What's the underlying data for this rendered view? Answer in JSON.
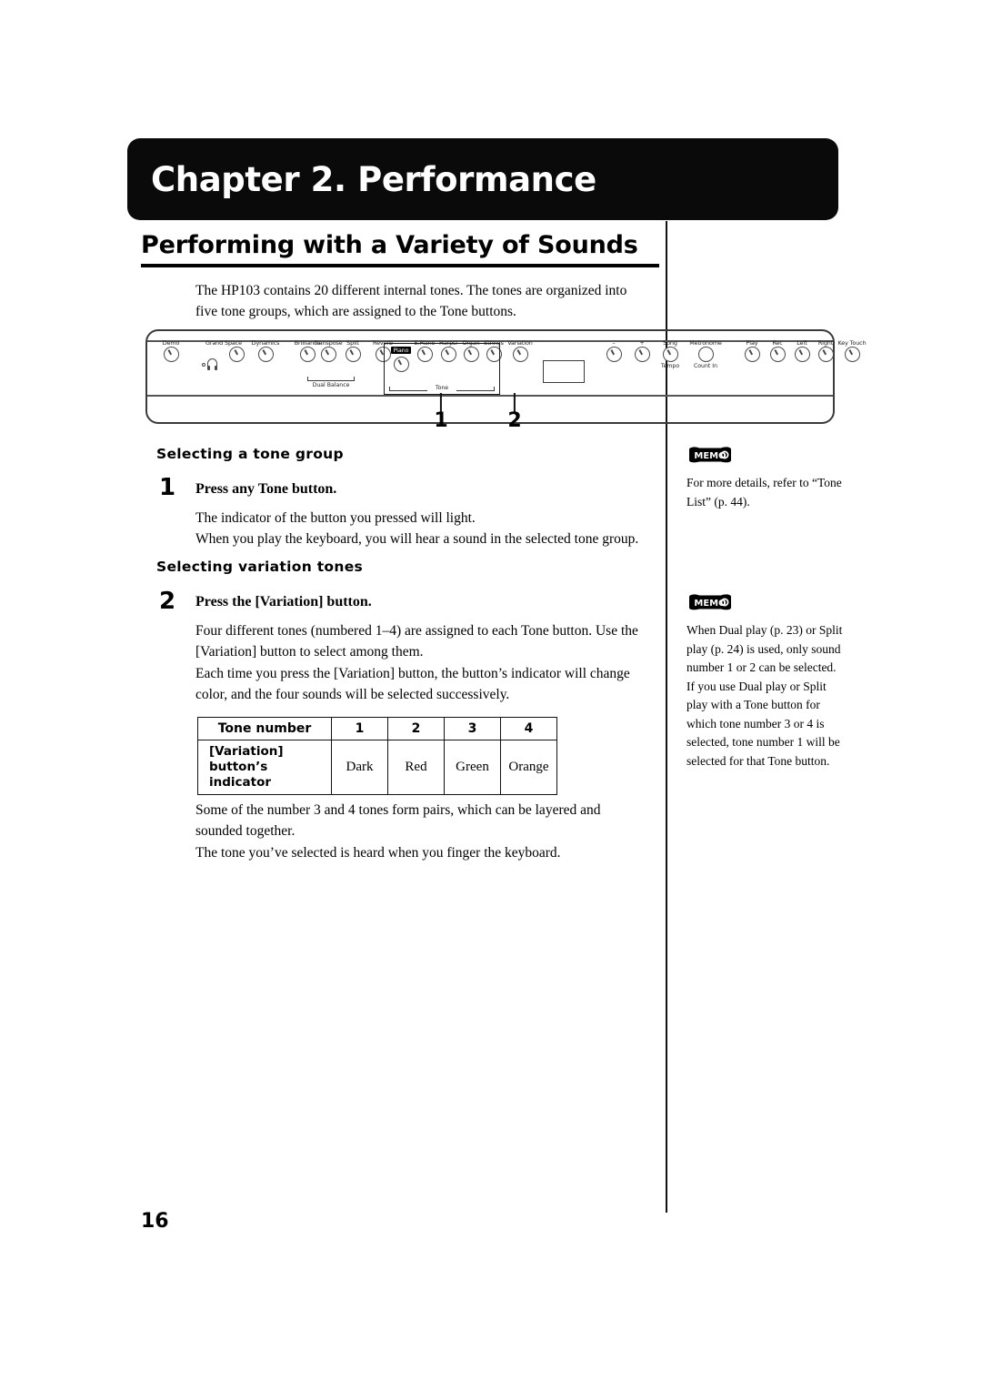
{
  "page": {
    "number": "16"
  },
  "chapter": {
    "title": "Chapter 2. Performance"
  },
  "section": {
    "title": "Performing with a Variety of Sounds",
    "intro": "The HP103 contains 20 different internal tones. The tones are organized into five tone groups, which are assigned to the Tone buttons."
  },
  "panel": {
    "left_controls": [
      {
        "label": "Demo"
      },
      {
        "label": "Grand Space"
      },
      {
        "label": "Dynamics"
      },
      {
        "label": "Brilliance"
      },
      {
        "label": "Transpose"
      },
      {
        "label": "Split"
      },
      {
        "label": "Reverb"
      }
    ],
    "dual_balance_label": "Dual Balance",
    "tone_group_label": "Tone",
    "tone_buttons": [
      {
        "label": "Piano",
        "selected": true
      },
      {
        "label": "E.Piano",
        "selected": false
      },
      {
        "label": "Harpsi",
        "selected": false
      },
      {
        "label": "Organ",
        "selected": false
      },
      {
        "label": "Strings",
        "selected": false
      }
    ],
    "variation_label": "Variation",
    "tempo_controls": [
      {
        "label": "–",
        "sub": ""
      },
      {
        "label": "+",
        "sub": ""
      },
      {
        "label": "Song",
        "sub": "Tempo"
      },
      {
        "label": "Metronome",
        "sub": "Count In"
      }
    ],
    "right_controls": [
      {
        "label": "Play"
      },
      {
        "label": "Rec"
      },
      {
        "label": "Left"
      },
      {
        "label": "Right"
      },
      {
        "label": "Key Touch"
      }
    ],
    "callouts": [
      {
        "number": "1"
      },
      {
        "number": "2"
      }
    ]
  },
  "content": {
    "heading1": "Selecting a tone group",
    "step1": {
      "number": "1",
      "title": "Press any Tone button.",
      "paragraphs": [
        "The indicator of the button you pressed will light.",
        "When you play the keyboard, you will hear a sound in the selected tone group."
      ]
    },
    "heading2": "Selecting variation tones",
    "step2": {
      "number": "2",
      "title": "Press the [Variation] button.",
      "paragraphs": [
        "Four different tones (numbered 1–4) are assigned to each Tone button. Use the [Variation] button to select among them.",
        "Each time you press the [Variation] button, the button’s indicator will change color, and the four sounds will be selected successively."
      ]
    },
    "after_table_paragraphs": [
      "Some of the number 3 and 4 tones form pairs, which can be layered and sounded together.",
      "The tone you’ve selected is heard when you finger the keyboard."
    ]
  },
  "table": {
    "header_label": "Tone number",
    "header_values": [
      "1",
      "2",
      "3",
      "4"
    ],
    "row_label_line1": "[Variation]",
    "row_label_line2": "button’s indicator",
    "row_values": [
      "Dark",
      "Red",
      "Green",
      "Orange"
    ]
  },
  "memos": [
    {
      "badge": "MEMO",
      "text": "For more details, refer to “Tone List” (p. 44)."
    },
    {
      "badge": "MEMO",
      "text": "When Dual play (p. 23) or Split play (p. 24) is used, only sound number 1 or 2 can be selected. If you use Dual play or Split play with a Tone button for which tone number 3 or 4 is selected, tone number 1 will be selected for that Tone button."
    }
  ]
}
